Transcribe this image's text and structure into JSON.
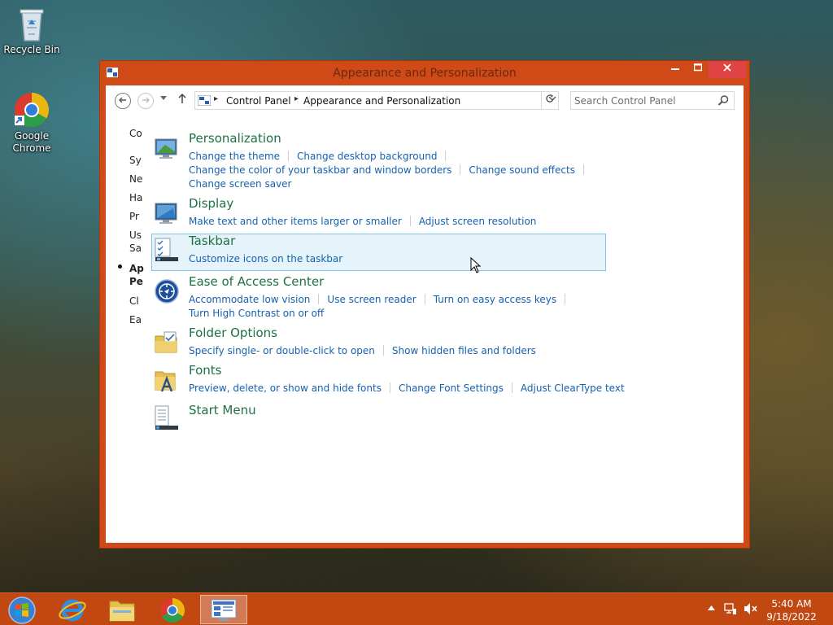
{
  "desktop": {
    "icons": [
      {
        "label": "Recycle Bin"
      },
      {
        "label": "Google Chrome"
      }
    ]
  },
  "window": {
    "title": "Appearance and Personalization",
    "address": {
      "crumbs": [
        "Control Panel",
        "Appearance and Personalization"
      ]
    },
    "search": {
      "placeholder": "Search Control Panel"
    },
    "sidebar_items": [
      "Co",
      "Sy",
      "Ne",
      "Ha",
      "Pr",
      "Us",
      "Sa",
      "Ap",
      "Pe",
      "Cl",
      "Ea"
    ],
    "categories": [
      {
        "title": "Personalization",
        "link_rows": [
          [
            "Change the theme",
            "Change desktop background"
          ],
          [
            "Change the color of your taskbar and window borders",
            "Change sound effects"
          ],
          [
            "Change screen saver"
          ]
        ]
      },
      {
        "title": "Display",
        "link_rows": [
          [
            "Make text and other items larger or smaller",
            "Adjust screen resolution"
          ]
        ]
      },
      {
        "title": "Taskbar",
        "link_rows": [
          [
            "Customize icons on the taskbar"
          ]
        ]
      },
      {
        "title": "Ease of Access Center",
        "link_rows": [
          [
            "Accommodate low vision",
            "Use screen reader",
            "Turn on easy access keys"
          ],
          [
            "Turn High Contrast on or off"
          ]
        ]
      },
      {
        "title": "Folder Options",
        "link_rows": [
          [
            "Specify single- or double-click to open",
            "Show hidden files and folders"
          ]
        ]
      },
      {
        "title": "Fonts",
        "link_rows": [
          [
            "Preview, delete, or show and hide fonts",
            "Change Font Settings",
            "Adjust ClearType text"
          ]
        ]
      },
      {
        "title": "Start Menu",
        "link_rows": []
      }
    ]
  },
  "taskbar": {
    "clock": {
      "time": "5:40 AM",
      "date": "9/18/2022"
    }
  },
  "colors": {
    "window_frame": "#cf4a16",
    "taskbar": "#c24812",
    "category_title": "#1e7145",
    "link": "#1561b0",
    "hover_background": "#e5f3fb"
  }
}
